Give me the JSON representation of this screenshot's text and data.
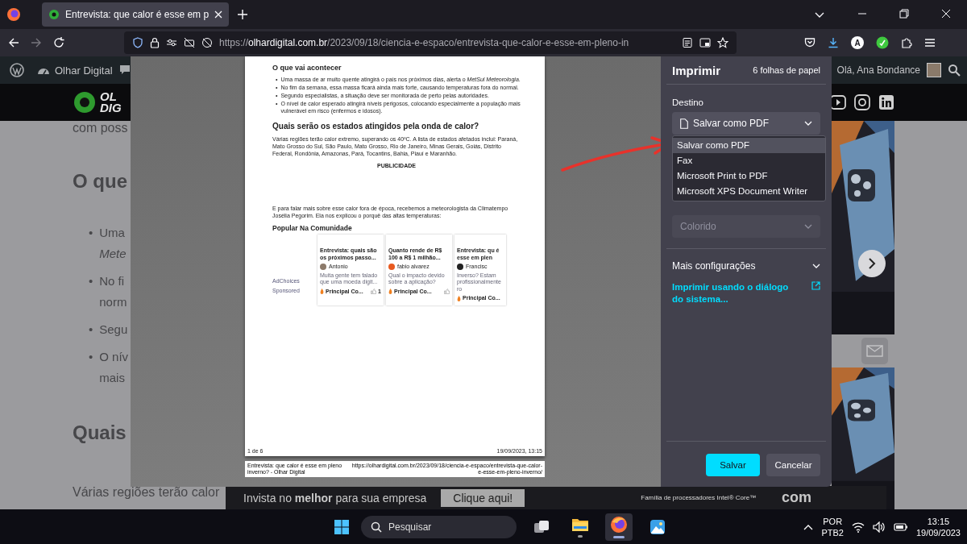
{
  "browser": {
    "tabs": [
      {
        "title": "Entrevista: que calor é esse em p",
        "selected": true
      }
    ],
    "url": {
      "scheme": "https://",
      "domain": "olhardigital.com.br",
      "path": "/2023/09/18/ciencia-e-espaco/entrevista-que-calor-e-esse-em-pleno-in"
    },
    "account_initial": "A"
  },
  "admin_bar": {
    "site_name": "Olhar Digital",
    "greeting": "Olá, Ana Bondance"
  },
  "site": {
    "logo_lines": [
      "OL",
      "DIG"
    ],
    "article": {
      "intro": "com poss",
      "heading_1": "O que",
      "bullet_marker": "•",
      "bullets": [
        {
          "lines": [
            "Uma",
            "*Mete*"
          ]
        },
        {
          "lines": [
            "No fi",
            "norm"
          ]
        },
        {
          "lines": [
            "Segu"
          ]
        },
        {
          "lines": [
            "O nív",
            "mais"
          ]
        }
      ],
      "heading_2": "Quais",
      "paragraph": "Várias regiões terão calor"
    }
  },
  "ad_banner": {
    "text": "Invista no **melhor** para sua empresa",
    "button": "Clique aqui!",
    "caption": "Família de processadores Intel® Core™",
    "fragment": "com"
  },
  "print": {
    "title": "Imprimir",
    "sheets": "6 folhas de papel",
    "destination_label": "Destino",
    "destination": "Salvar como PDF",
    "destination_options": [
      {
        "label": "Salvar como PDF",
        "selected": true
      },
      {
        "label": "Fax",
        "selected": false
      },
      {
        "label": "Microsoft Print to PDF",
        "selected": false
      },
      {
        "label": "Microsoft XPS Document Writer",
        "selected": false
      }
    ],
    "color_mode": {
      "value": "Colorido",
      "disabled": true
    },
    "more_settings": {
      "label": "Mais configurações",
      "expanded": false
    },
    "system_dialog_link": "Imprimir usando o diálogo do sistema...",
    "buttons": [
      {
        "label": "Salvar",
        "kind": "primary"
      },
      {
        "label": "Cancelar",
        "kind": "secondary"
      }
    ],
    "preview": {
      "heading_1": "O que vai acontecer",
      "bullet_marker": "•",
      "bullets": [
        "Uma massa de ar muito quente atingirá o país nos próximos dias, alerta o *MetSul Meteorologia*.",
        "No fim da semana, essa massa ficará ainda mais forte, causando temperaturas fora do normal.",
        "Segundo especialistas, a situação deve ser monitorada de perto pelas autoridades.",
        "O nível de calor esperado atingirá níveis perigosos, colocando especialmente a população mais vulnerável em risco (enfermos e idosos)."
      ],
      "heading_2": "Quais serão os estados atingidos pela onda de calor?",
      "paragraph_1": "Várias regiões terão calor extremo, superando os 40ºC. A lista de estados afetados inclui: Paraná, Mato Grosso do Sul, São Paulo, Mato Grosso, Rio de Janeiro, Minas Gerais, Goiás, Distrito Federal, Rondônia, Amazonas, Pará, Tocantins, Bahia, Piauí e Maranhão.",
      "ad_label": "PUBLICIDADE",
      "paragraph_2": "E para falar mais sobre esse calor fora de época, recebemos a meteorologista da Climatempo Josélia Pegorim. Ela nos explicou o porquê das altas temperaturas:",
      "section_title": "Popular Na Comunidade",
      "adchoices": "AdChoices",
      "sponsored": "Sponsored",
      "cards": [
        {
          "title": "Entrevista: quais são os próximos passo...",
          "author": "Antonio",
          "excerpt": "Muita gente tem falado que uma moeda digit...",
          "tag": "Principal Co...",
          "like_button": true,
          "likes": "1"
        },
        {
          "title": "Quanto rende de R$ 100 a R$ 1 milhão...",
          "author": "fabio alvarez",
          "excerpt": "Qual o impacto devido sobre a aplicação?",
          "tag": "Principal Co...",
          "like_button": true
        },
        {
          "title": "Entrevista: qu é esse em plen",
          "author": "Francisc",
          "excerpt": "Inverso? Estam profissionalmente ro",
          "tag": "Principal Co...",
          "like_button": false
        }
      ],
      "page_number": "1 de 6",
      "printed_at": "19/09/2023, 13:15",
      "next_page_title": "Entrevista: que calor é esse em pleno inverno? - Olhar Digital",
      "next_page_url": "https://olhardigital.com.br/2023/09/18/ciencia-e-espaco/entrevista-que-calor-e-esse-em-pleno-inverno/"
    }
  },
  "taskbar": {
    "search_placeholder": "Pesquisar",
    "apps": [
      {
        "kind": "task-view",
        "selected": false,
        "running": false
      },
      {
        "kind": "files",
        "selected": false,
        "running": true
      },
      {
        "kind": "firefox",
        "selected": true,
        "running": true
      },
      {
        "kind": "photos",
        "selected": false,
        "running": false
      }
    ],
    "language": "POR",
    "layout": "PTB2",
    "time": "13:15",
    "date": "19/09/2023"
  }
}
